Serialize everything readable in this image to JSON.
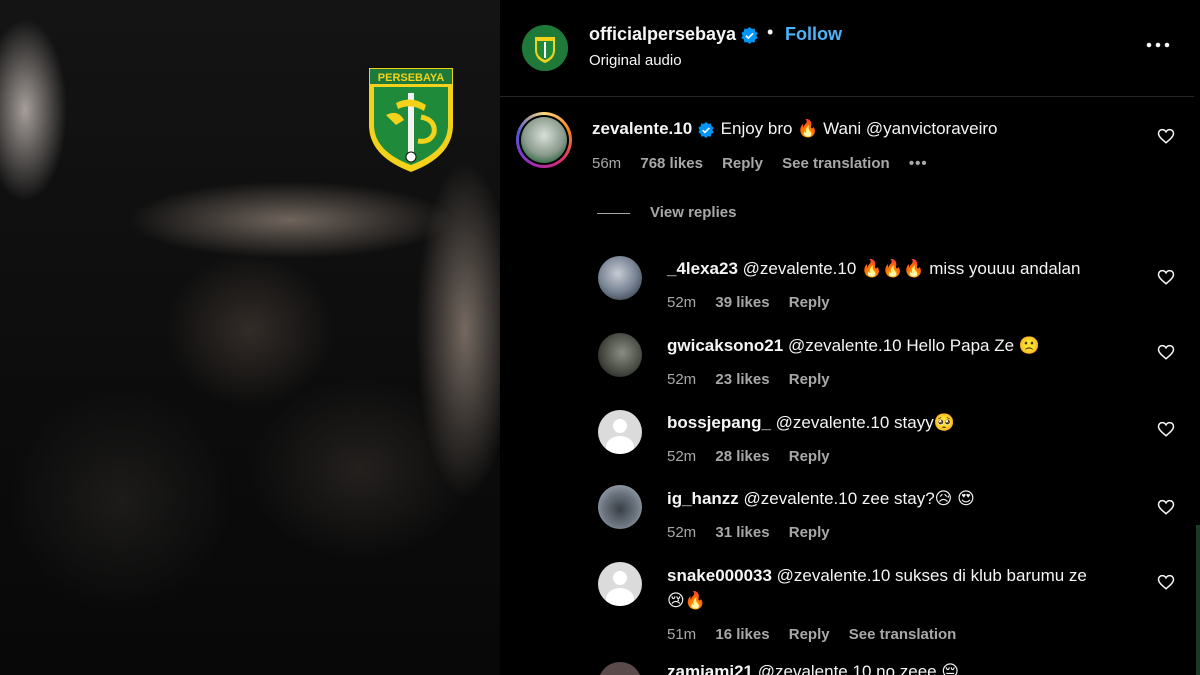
{
  "crest": {
    "text": "PERSEBAYA"
  },
  "post": {
    "username": "officialpersebaya",
    "separator": "•",
    "follow": "Follow",
    "audio": "Original audio"
  },
  "comments": [
    {
      "user": "zevalente.10",
      "verified": true,
      "text": "Enjoy bro 🔥 Wani @yanvictoraveiro",
      "time": "56m",
      "likes": "768 likes",
      "reply": "Reply",
      "translation": "See translation",
      "more": "•••"
    },
    {
      "user": "_4lexa23",
      "text": "@zevalente.10 🔥🔥🔥 miss youuu andalan",
      "time": "52m",
      "likes": "39 likes",
      "reply": "Reply"
    },
    {
      "user": "gwicaksono21",
      "text": "@zevalente.10 Hello Papa Ze 🙁",
      "time": "52m",
      "likes": "23 likes",
      "reply": "Reply"
    },
    {
      "user": "bossjepang_",
      "text": "@zevalente.10 stayy🥺",
      "time": "52m",
      "likes": "28 likes",
      "reply": "Reply"
    },
    {
      "user": "ig_hanzz",
      "text": "@zevalente.10 zee stay?😥 😍",
      "time": "52m",
      "likes": "31 likes",
      "reply": "Reply"
    },
    {
      "user": "snake000033",
      "text": "@zevalente.10 sukses di klub barumu ze",
      "text2": "😢🔥",
      "time": "51m",
      "likes": "16 likes",
      "reply": "Reply",
      "translation": "See translation"
    },
    {
      "user": "zamiami21",
      "text": "@zevalente.10 no zeee 😔"
    }
  ],
  "view_replies": "View replies",
  "colors": {
    "accent": "#4cb5f9",
    "verified": "#0095f6",
    "brand_green": "#1f7a3a",
    "muted": "#a8a8a8"
  }
}
